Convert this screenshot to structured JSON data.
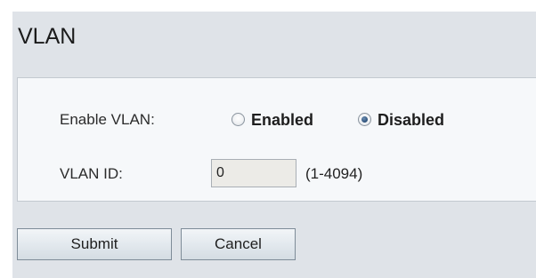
{
  "section": {
    "title": "VLAN"
  },
  "form": {
    "enable_vlan": {
      "label": "Enable VLAN:",
      "options": [
        {
          "label": "Enabled",
          "checked": false
        },
        {
          "label": "Disabled",
          "checked": true
        }
      ]
    },
    "vlan_id": {
      "label": "VLAN ID:",
      "value": "0",
      "range_hint": "(1-4094)"
    }
  },
  "buttons": {
    "submit_label": "Submit",
    "cancel_label": "Cancel"
  }
}
